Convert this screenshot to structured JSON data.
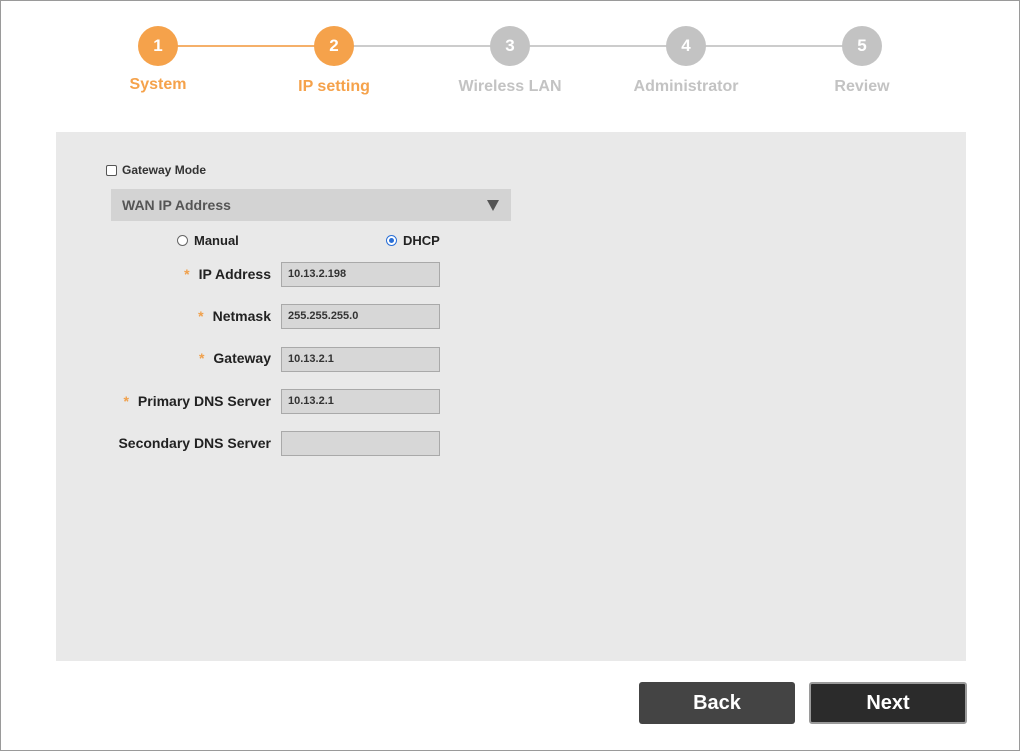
{
  "steps": [
    {
      "number": "1",
      "label": "System",
      "state": "done"
    },
    {
      "number": "2",
      "label": "IP setting",
      "state": "active"
    },
    {
      "number": "3",
      "label": "Wireless LAN",
      "state": "pending"
    },
    {
      "number": "4",
      "label": "Administrator",
      "state": "pending"
    },
    {
      "number": "5",
      "label": "Review",
      "state": "pending"
    }
  ],
  "colors": {
    "accent": "#f5a24b",
    "inactive": "#c3c3c3",
    "accent_line": "#f5b06a",
    "inactive_line": "#cccccc"
  },
  "gateway_mode": {
    "label": "Gateway Mode",
    "checked": false
  },
  "section": {
    "title": "WAN IP Address",
    "caret_icon": "triangle-down-icon"
  },
  "mode": {
    "manual_label": "Manual",
    "dhcp_label": "DHCP",
    "selected": "DHCP"
  },
  "fields": {
    "ip_address": {
      "label": "IP Address",
      "required": "*",
      "value": "10.13.2.198"
    },
    "netmask": {
      "label": "Netmask",
      "required": "*",
      "value": "255.255.255.0"
    },
    "gateway": {
      "label": "Gateway",
      "required": "*",
      "value": "10.13.2.1"
    },
    "primary_dns": {
      "label": "Primary DNS Server",
      "required": "*",
      "value": "10.13.2.1"
    },
    "secondary_dns": {
      "label": "Secondary DNS Server",
      "value": ""
    }
  },
  "buttons": {
    "back": "Back",
    "next": "Next"
  }
}
